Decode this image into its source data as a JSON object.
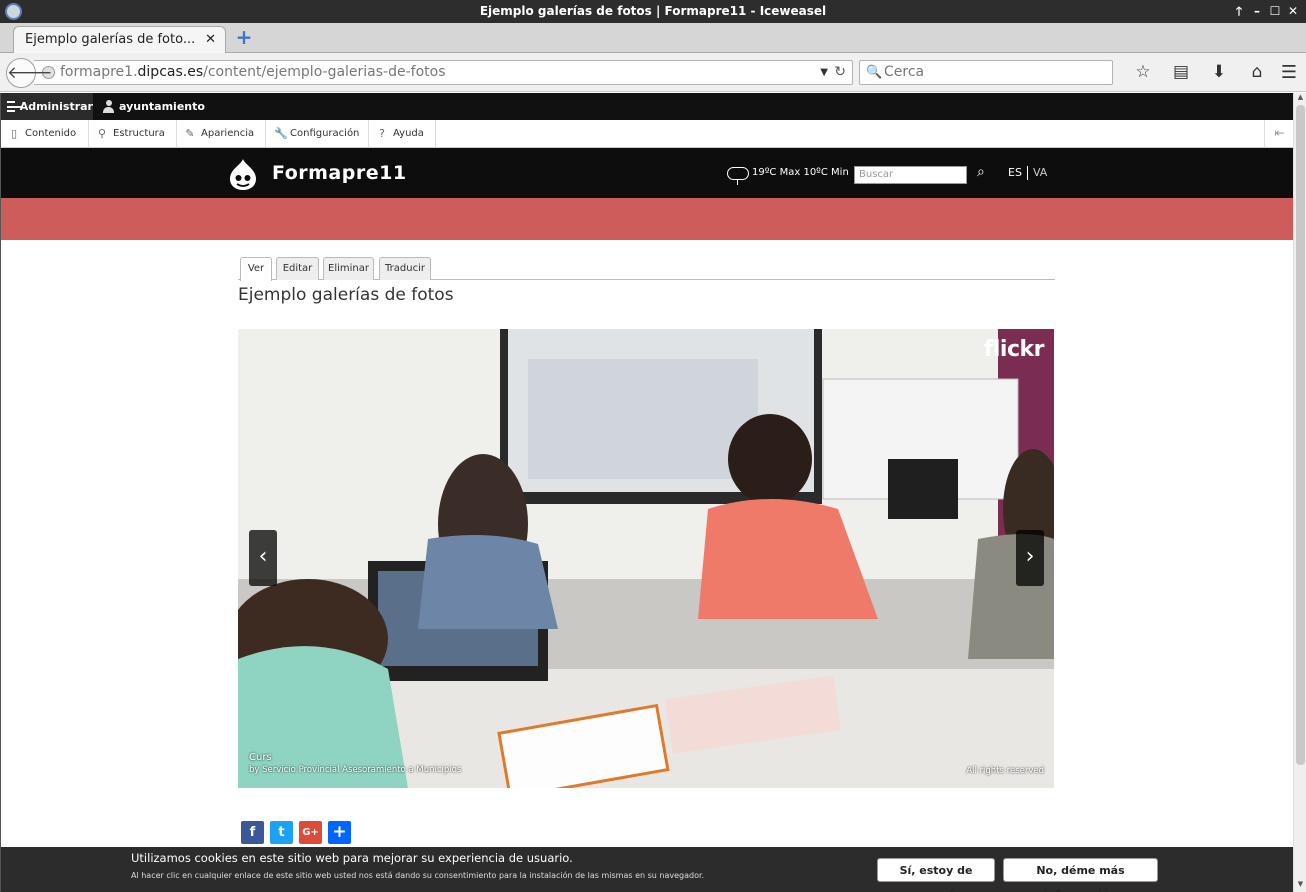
{
  "window": {
    "title": "Ejemplo galerías de fotos | Formapre11 - Iceweasel",
    "controls": [
      "🡑",
      "–",
      "☐",
      "✕"
    ]
  },
  "tab": {
    "label": "Ejemplo galerías de foto...",
    "close": "✕",
    "new_tab": "+"
  },
  "navbar": {
    "back": "🡐",
    "url_prefix": "formapre1.",
    "url_domain": "dipcas.es",
    "url_path": "/content/ejemplo-galerias-de-fotos",
    "search_placeholder": "Cerca",
    "icons": [
      "star-icon",
      "reading-list-icon",
      "download-icon",
      "home-icon",
      "menu-icon"
    ]
  },
  "admin": {
    "manage": "Administrar",
    "user": "ayuntamiento",
    "tray": [
      "Contenido",
      "Estructura",
      "Apariencia",
      "Configuración",
      "Ayuda"
    ]
  },
  "site": {
    "name": "Formapre11",
    "weather": "19ºC Max 10ºC Min",
    "search_placeholder": "Buscar",
    "lang_es": "ES",
    "lang_va": "VA",
    "red_band_color": "#cd5c5a"
  },
  "page": {
    "tabs": [
      "Ver",
      "Editar",
      "Eliminar",
      "Traducir"
    ],
    "title": "Ejemplo galerías de fotos"
  },
  "gallery": {
    "brand": "flickr",
    "caption_title": "Curs",
    "caption_by": "by Servicio Provincial Asesoramiento a Municipios",
    "rights": "All rights reserved",
    "prev": "‹",
    "next": "›"
  },
  "share": [
    {
      "icon": "facebook-icon",
      "glyph": "f",
      "color": "#3b5998"
    },
    {
      "icon": "twitter-icon",
      "glyph": "t",
      "color": "#1da1f2"
    },
    {
      "icon": "google-plus-icon",
      "glyph": "G+",
      "color": "#dd4b39"
    },
    {
      "icon": "share-plus-icon",
      "glyph": "+",
      "color": "#0166ff"
    }
  ],
  "cookie": {
    "message": "Utilizamos cookies en este sitio web para mejorar su experiencia de usuario.",
    "sub": "Al hacer clic en cualquier enlace de este sitio web usted nos está dando su consentimiento para la instalación de las mismas en su navegador.",
    "accept": "Sí, estoy de acuerdo",
    "more": "No, déme más información"
  }
}
